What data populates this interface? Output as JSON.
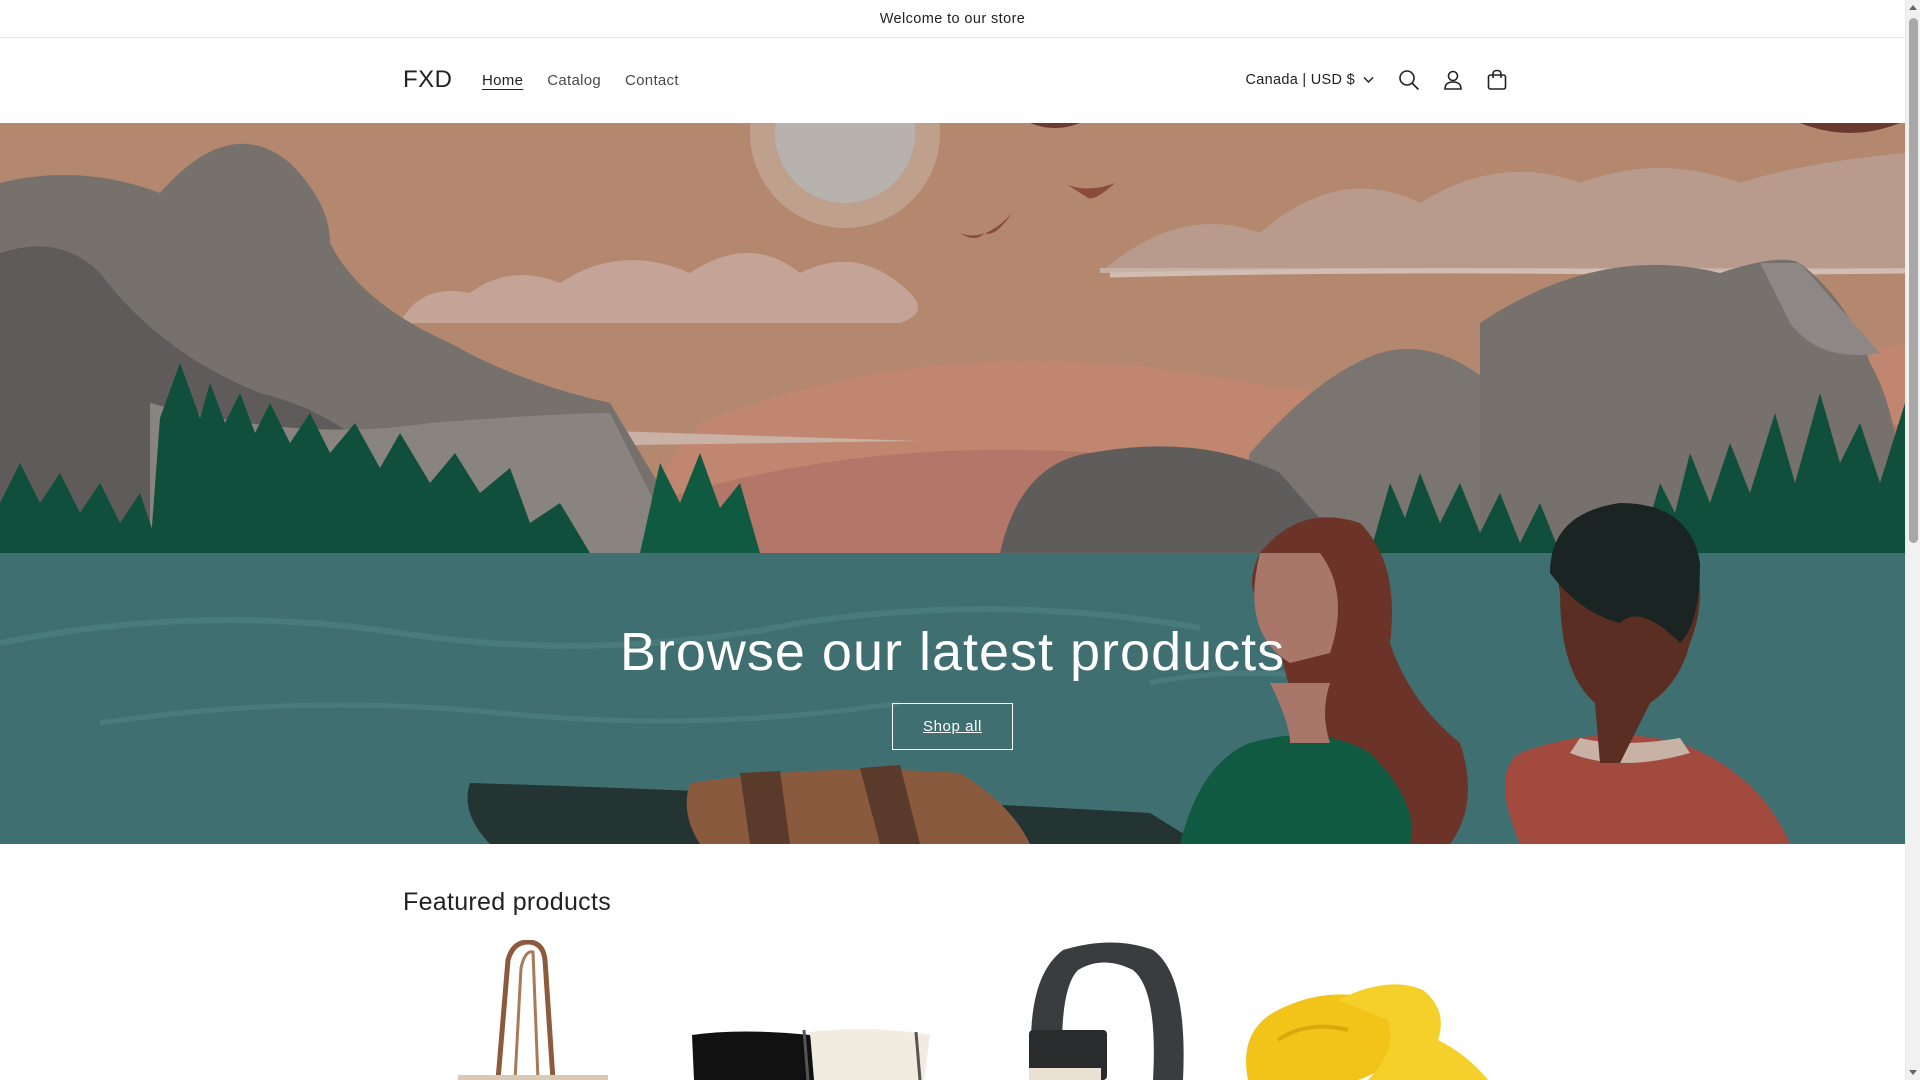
{
  "announcement": {
    "text": "Welcome to our store"
  },
  "header": {
    "logo": "FXD",
    "nav": [
      {
        "label": "Home",
        "active": true
      },
      {
        "label": "Catalog",
        "active": false
      },
      {
        "label": "Contact",
        "active": false
      }
    ],
    "country_selector": "Canada | USD $",
    "icons": [
      "search-icon",
      "account-icon",
      "cart-icon"
    ]
  },
  "hero": {
    "title": "Browse our latest products",
    "button_label": "Shop all"
  },
  "featured": {
    "title": "Featured products",
    "products": [
      {
        "image": "tote-bag"
      },
      {
        "image": "canvas-bags-black-white"
      },
      {
        "image": "nylon-belt"
      },
      {
        "image": "yellow-slides"
      }
    ]
  },
  "colors": {
    "accent_text": "#121212",
    "hero_lake": "#3d6e70",
    "hero_sky": "#b58a73"
  }
}
